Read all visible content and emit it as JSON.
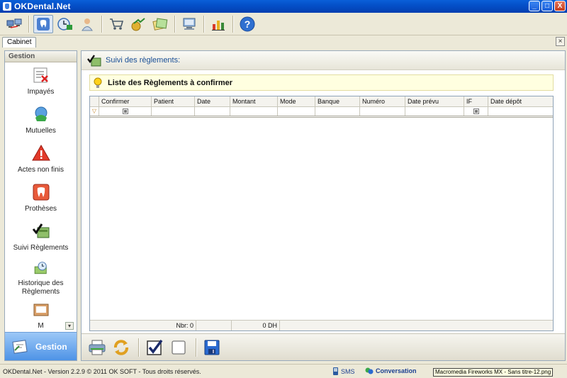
{
  "window": {
    "title": "OKDental.Net",
    "minimize": "_",
    "maximize": "□",
    "close": "X"
  },
  "toolbar": {
    "icons": [
      "network-icon",
      "tooth-icon",
      "appointments-icon",
      "patient-icon",
      "cart-icon",
      "finance-icon",
      "documents-icon",
      "computer-icon",
      "stats-icon",
      "help-icon"
    ]
  },
  "tabs": {
    "active_tab": "Cabinet",
    "close_glyph": "×"
  },
  "sidebar": {
    "header": "Gestion",
    "items": [
      {
        "label": "Impayés",
        "icon": "unpaid-icon"
      },
      {
        "label": "Mutuelles",
        "icon": "insurance-icon"
      },
      {
        "label": "Actes non finis",
        "icon": "warning-icon"
      },
      {
        "label": "Prothèses",
        "icon": "prosthesis-icon"
      },
      {
        "label": "Suivi Règlements",
        "icon": "payments-check-icon"
      },
      {
        "label": "Historique des Règlements",
        "icon": "history-icon"
      },
      {
        "label": "M",
        "icon": "tray-icon"
      }
    ],
    "scroll_glyph": "▾",
    "footer_label": "Gestion"
  },
  "panel": {
    "title": "Suivi des règlements:",
    "banner": "Liste des Règlements à confirmer",
    "columns": [
      "Confirmer",
      "Patient",
      "Date",
      "Montant",
      "Mode",
      "Banque",
      "Numéro",
      "Date prévu",
      "IF",
      "Date dépôt"
    ],
    "filter_glyph": "▽",
    "footer": {
      "count": "Nbr: 0",
      "total": "0 DH"
    }
  },
  "bottom_tools": [
    "print-icon",
    "refresh-icon",
    "check-all-icon",
    "uncheck-all-icon",
    "save-icon"
  ],
  "status": {
    "version": "OKDental.Net - Version 2.2.9 © 2011 OK SOFT - Tous droits réservés.",
    "sms": "SMS",
    "conversation": "Conversation",
    "tooltip": "Macromedia Fireworks MX - Sans titre-12.png"
  },
  "colors": {
    "title_bar": "#0450c9",
    "accent": "#1a4f96",
    "banner_bg": "#ffffe0",
    "gestion_bg": "#4e93e6"
  }
}
